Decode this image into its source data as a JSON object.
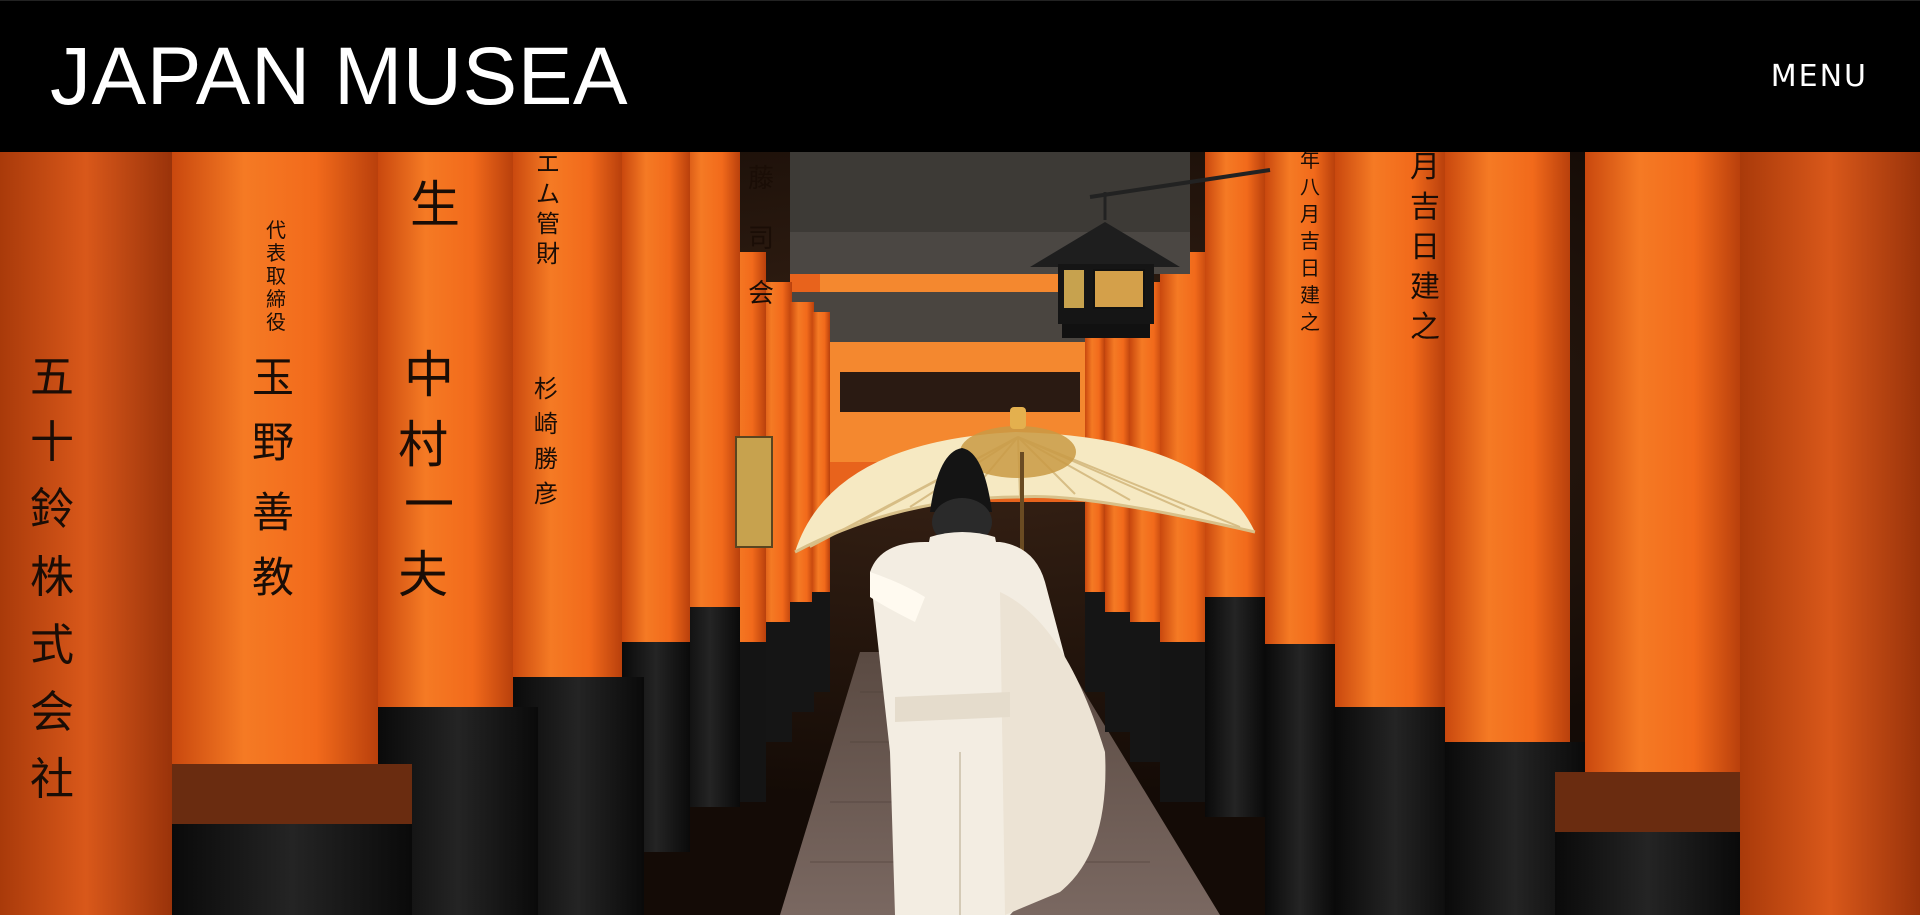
{
  "header": {
    "brand": "JAPAN MUSEA",
    "menu_label": "MENU"
  },
  "hero": {
    "alt_subject": "torii-gate-corridor",
    "colors": {
      "pillar_orange": "#f26a1b",
      "pillar_dark": "#c7470f",
      "base_black": "#101010",
      "robe_white": "#f3ede2",
      "umbrella_cream": "#f6e9c2"
    },
    "inscriptions": {
      "p1": [
        "五",
        "十",
        "鈴",
        "株",
        "式",
        "会",
        "社"
      ],
      "p2": [
        "代",
        "表",
        "取",
        "締",
        "役"
      ],
      "p2_name": [
        "玉",
        "野",
        "善",
        "教"
      ],
      "p3": [
        "生",
        "中",
        "村",
        "一",
        "夫"
      ],
      "p4": [
        "エ",
        "ム",
        "管",
        "財"
      ],
      "p4_b": [
        "杉",
        "崎",
        "勝",
        "彦"
      ],
      "p6": [
        "藤",
        "司",
        "会"
      ],
      "p_right1": [
        "月",
        "吉",
        "日",
        "建",
        "之"
      ],
      "p_right2": [
        "年",
        "八",
        "月",
        "吉",
        "日",
        "建",
        "之"
      ]
    }
  }
}
